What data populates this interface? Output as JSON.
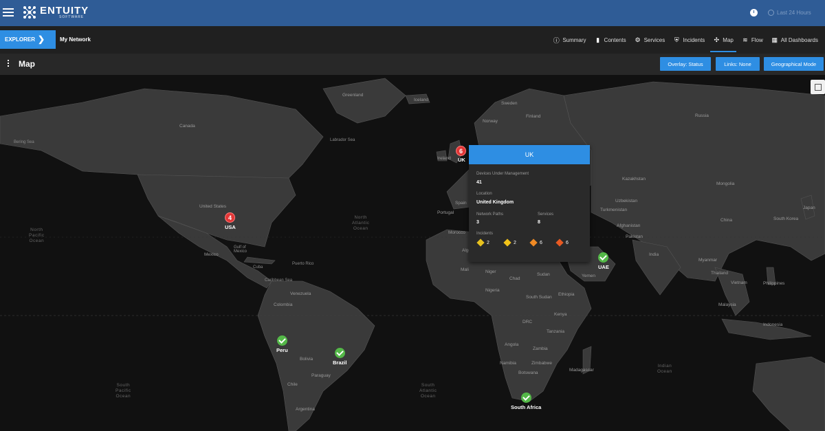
{
  "topbar": {
    "brand_name": "ENTUITY",
    "brand_sub": "SOFTWARE",
    "time_range": "Last 24 Hours"
  },
  "navbar": {
    "explorer_label": "EXPLORER",
    "breadcrumb": "My Network",
    "tabs": [
      {
        "label": "Summary",
        "icon": "info-icon"
      },
      {
        "label": "Contents",
        "icon": "folder-icon"
      },
      {
        "label": "Services",
        "icon": "services-icon"
      },
      {
        "label": "Incidents",
        "icon": "incidents-icon"
      },
      {
        "label": "Map",
        "icon": "map-icon",
        "active": true
      },
      {
        "label": "Flow",
        "icon": "flow-icon"
      },
      {
        "label": "All Dashboards",
        "icon": "dashboards-icon"
      }
    ]
  },
  "mapheader": {
    "title": "Map",
    "overlay_button": "Overlay: Status",
    "links_button": "Links: None",
    "mode_button": "Geographical Mode"
  },
  "map": {
    "oceans": {
      "north_pacific": "North\nPacific\nOcean",
      "north_atlantic": "North\nAtlantic\nOcean",
      "south_pacific": "South\nPacific\nOcean",
      "south_atlantic": "South\nAtlantic\nOcean",
      "indian": "Indian\nOcean"
    },
    "labels": {
      "greenland": "Greenland",
      "iceland": "Iceland",
      "sweden": "Sweden",
      "finland": "Finland",
      "norway": "Norway",
      "russia": "Russia",
      "canada": "Canada",
      "bering_sea": "Bering Sea",
      "labrador_sea": "Labrador Sea",
      "ireland": "Ireland",
      "united_states": "United States",
      "mexico": "Mexico",
      "gulf_of_mexico": "Gulf of\nMexico",
      "cuba": "Cuba",
      "puerto_rico": "Puerto Rico",
      "caribbean": "Caribbean Sea",
      "venezuela": "Venezuela",
      "colombia": "Colombia",
      "bolivia": "Bolivia",
      "paraguay": "Paraguay",
      "chile": "Chile",
      "argentina": "Argentina",
      "spain": "Spain",
      "portugal": "Portugal",
      "morocco": "Morocco",
      "algeria": "Algeria",
      "mali": "Mali",
      "niger": "Niger",
      "chad": "Chad",
      "sudan": "Sudan",
      "nigeria": "Nigeria",
      "south_sudan": "South Sudan",
      "ethiopia": "Ethiopia",
      "kenya": "Kenya",
      "drc": "DRC",
      "tanzania": "Tanzania",
      "angola": "Angola",
      "zambia": "Zambia",
      "namibia": "Namibia",
      "zimbabwe": "Zimbabwe",
      "botswana": "Botswana",
      "madagascar": "Madagascar",
      "kazakhstan": "Kazakhstan",
      "mongolia": "Mongolia",
      "china": "China",
      "turkmenistan": "Turkmenistan",
      "afghanistan": "Afghanistan",
      "pakistan": "Pakistan",
      "india": "India",
      "uzbekistan": "Uzbekistan",
      "myanmar": "Myanmar",
      "thailand": "Thailand",
      "vietnam": "Vietnam",
      "philippines": "Philippines",
      "malaysia": "Malaysia",
      "indonesia": "Indonesia",
      "yemen": "Yemen",
      "south_korea": "South Korea",
      "japan": "Japan"
    },
    "markers": [
      {
        "id": "usa",
        "label": "USA",
        "status": "red",
        "count": "4"
      },
      {
        "id": "uk",
        "label": "UK",
        "status": "red",
        "count": "6"
      },
      {
        "id": "uae",
        "label": "UAE",
        "status": "green",
        "count": ""
      },
      {
        "id": "peru",
        "label": "Peru",
        "status": "green",
        "count": ""
      },
      {
        "id": "brazil",
        "label": "Brazil",
        "status": "green",
        "count": ""
      },
      {
        "id": "south_africa",
        "label": "South Africa",
        "status": "green",
        "count": ""
      }
    ]
  },
  "popup": {
    "title": "UK",
    "devices_label": "Devices Under Management",
    "devices_value": "41",
    "location_label": "Location",
    "location_value": "United Kingdom",
    "network_paths_label": "Network Paths",
    "network_paths_value": "3",
    "services_label": "Services",
    "services_value": "8",
    "incidents_label": "Incidents",
    "incidents": [
      {
        "severity": "minor",
        "count": "2",
        "color": "#e8c21f"
      },
      {
        "severity": "warning",
        "count": "2",
        "color": "#f2c319"
      },
      {
        "severity": "major",
        "count": "6",
        "color": "#f08a24"
      },
      {
        "severity": "critical",
        "count": "6",
        "color": "#e85a22"
      }
    ]
  }
}
